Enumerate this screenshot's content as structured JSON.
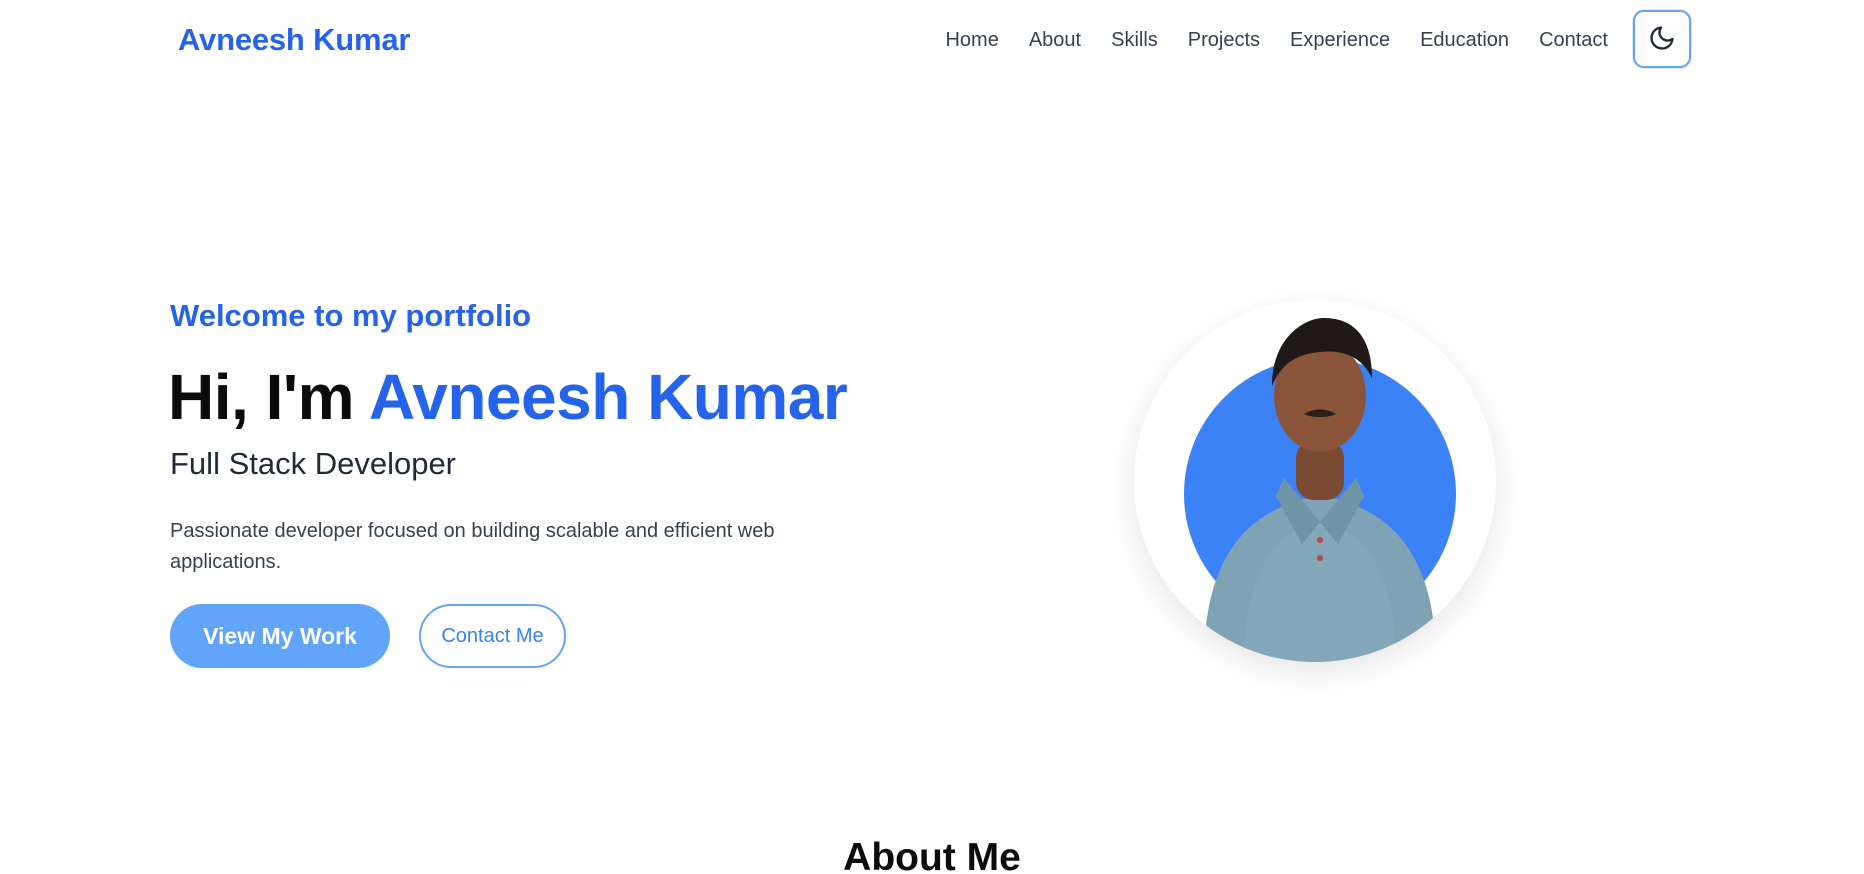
{
  "nav": {
    "brand": "Avneesh Kumar",
    "links": [
      "Home",
      "About",
      "Skills",
      "Projects",
      "Experience",
      "Education",
      "Contact"
    ],
    "theme_toggle_icon": "moon-icon"
  },
  "hero": {
    "welcome": "Welcome to my portfolio",
    "greeting": "Hi, I'm",
    "name": "Avneesh Kumar",
    "role": "Full Stack Developer",
    "description": "Passionate developer focused on building scalable and efficient web applications.",
    "primary_cta": "View My Work",
    "secondary_cta": "Contact Me"
  },
  "about": {
    "title": "About Me"
  },
  "colors": {
    "accent": "#2563eb",
    "button": "#60a5fa",
    "profile_circle": "#3b82f6"
  }
}
